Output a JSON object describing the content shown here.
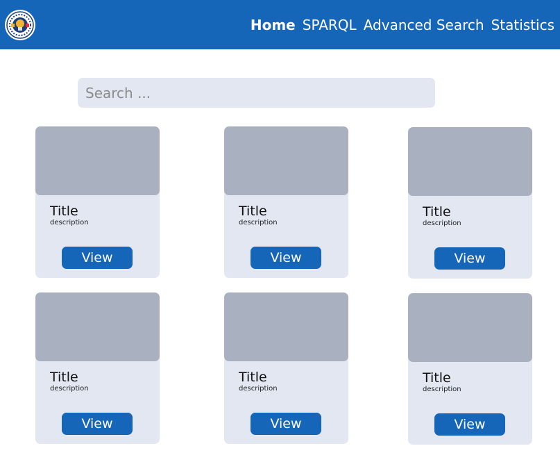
{
  "header": {
    "logo_icon": "lightbulb-gear-emblem-icon",
    "nav": [
      {
        "label": "Home",
        "active": true
      },
      {
        "label": "SPARQL",
        "active": false
      },
      {
        "label": "Advanced Search",
        "active": false
      },
      {
        "label": "Statistics",
        "active": false
      }
    ]
  },
  "search": {
    "placeholder": "Search ..."
  },
  "cards": [
    {
      "title": "Title",
      "description": "description",
      "button": "View"
    },
    {
      "title": "Title",
      "description": "description",
      "button": "View"
    },
    {
      "title": "Title",
      "description": "description",
      "button": "View"
    },
    {
      "title": "Title",
      "description": "description",
      "button": "View"
    },
    {
      "title": "Title",
      "description": "description",
      "button": "View"
    }
  ],
  "colors": {
    "brand": "#1565b8",
    "card_bg": "#e2e7f2",
    "thumb_bg": "#a9b1c1"
  }
}
